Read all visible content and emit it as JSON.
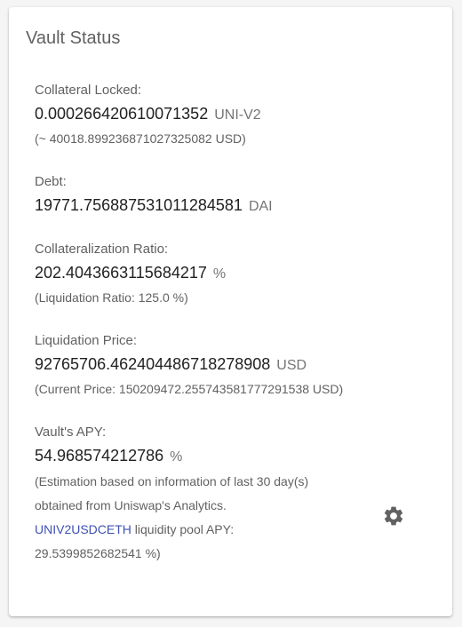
{
  "card": {
    "title": "Vault Status"
  },
  "collateral": {
    "label": "Collateral Locked:",
    "value": "0.000266420610071352",
    "unit": "UNI-V2",
    "usd_note": "(~ 40018.899236871027325082 USD)"
  },
  "debt": {
    "label": "Debt:",
    "value": "19771.756887531011284581",
    "unit": "DAI"
  },
  "collateralization": {
    "label": "Collateralization Ratio:",
    "value": "202.404366311568421​7",
    "unit": "%",
    "note": "(Liquidation Ratio: 125.0 %)"
  },
  "liquidation": {
    "label": "Liquidation Price:",
    "value": "92765706.462404486718278908",
    "unit": "USD",
    "note": "(Current Price: 150209472.255743581777291538 USD)"
  },
  "apy": {
    "label": "Vault's APY:",
    "value": "54.968574212786",
    "unit": "%",
    "note_line1": "(Estimation based on information of last 30 day(s)",
    "note_line2": "obtained from Uniswap's Analytics.",
    "pool_link": "UNIV2USDCETH",
    "pool_text": " liquidity pool APY:",
    "pool_value": "29.5399852682541 %)"
  },
  "icons": {
    "settings": "gear-icon"
  },
  "colors": {
    "link": "#3f51b5",
    "icon": "#616161"
  }
}
